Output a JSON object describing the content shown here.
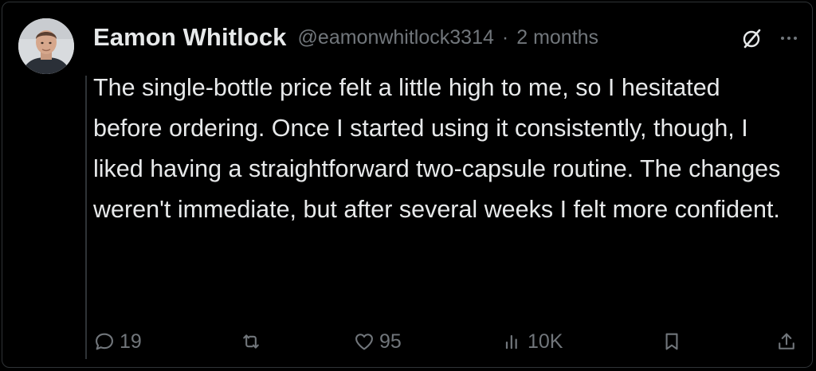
{
  "post": {
    "author_name": "Eamon Whitlock",
    "handle": "@eamonwhitlock3314",
    "separator": "·",
    "timestamp": "2 months",
    "text": "The single-bottle price felt a little high to me, so I hesitated before ordering. Once I started using it consistently, though, I liked having a straightforward two-capsule routine. The changes weren't immediate, but after several weeks I felt more confident.",
    "avatar_icon": "user-avatar"
  },
  "actions": {
    "reply_count": "19",
    "repost_count": "",
    "like_count": "95",
    "views_count": "10K"
  },
  "colors": {
    "background": "#000000",
    "text_primary": "#e7e9ea",
    "text_secondary": "#71767b",
    "border": "#2f3336"
  }
}
